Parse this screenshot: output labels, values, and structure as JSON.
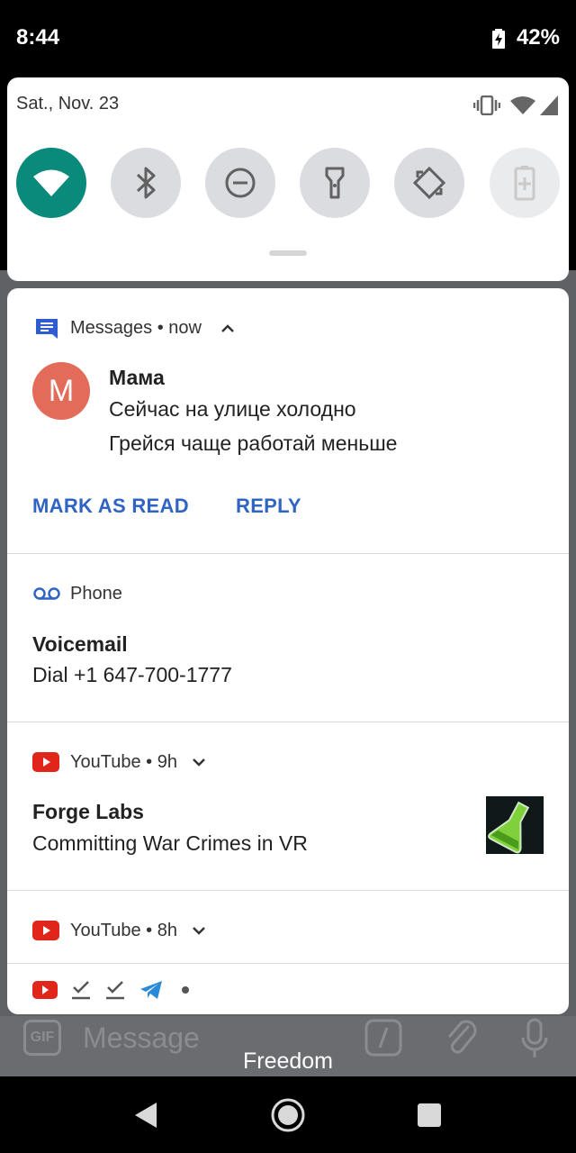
{
  "status_bar": {
    "time": "8:44",
    "battery": "42%"
  },
  "background_app": {
    "message_placeholder": "Message",
    "gif_label": "GIF",
    "keyboard_hint": "Freedom"
  },
  "quick_settings": {
    "date": "Sat., Nov. 23",
    "tiles": [
      {
        "name": "wifi",
        "state": "on"
      },
      {
        "name": "bluetooth",
        "state": "off"
      },
      {
        "name": "do-not-disturb",
        "state": "off"
      },
      {
        "name": "flashlight",
        "state": "off"
      },
      {
        "name": "auto-rotate",
        "state": "off"
      },
      {
        "name": "battery-saver",
        "state": "disabled"
      }
    ]
  },
  "notifications": {
    "messages": {
      "app": "Messages",
      "time": "now",
      "avatar_letter": "M",
      "sender": "Мама",
      "line1": "Сейчас на улице холодно",
      "line2": "Грейся чаще работай меньше",
      "action_mark_read": "MARK AS READ",
      "action_reply": "REPLY"
    },
    "phone": {
      "app": "Phone",
      "title": "Voicemail",
      "body": "Dial +1 647-700-1777"
    },
    "youtube1": {
      "app": "YouTube",
      "time": "9h",
      "title": "Forge Labs",
      "body": "Committing War Crimes in VR"
    },
    "youtube2": {
      "app": "YouTube",
      "time": "8h"
    }
  },
  "colors": {
    "accent_teal": "#0a8a7b",
    "action_blue": "#2f64c4",
    "youtube_red": "#e0251b",
    "avatar": "#e26b5a"
  }
}
